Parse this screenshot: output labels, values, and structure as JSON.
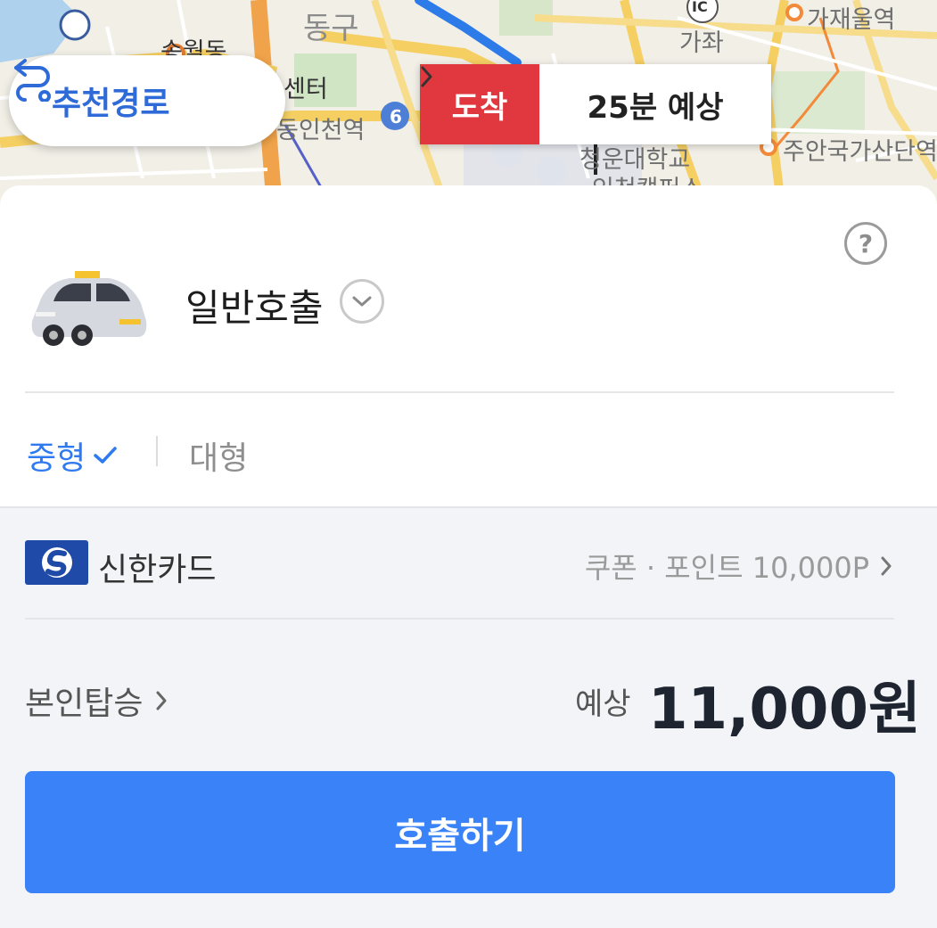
{
  "map": {
    "labels": {
      "donggu": "동구",
      "songwoldong": "송월동",
      "center_partial": "센터",
      "dongincheon_station": "동인천역",
      "gajae_station": "가재울역",
      "gaja": "가좌",
      "ic": "IC",
      "cheongun_univ": "청운대학교",
      "incheon_campus": "인천캠퍼스",
      "juan_industrial": "주안국가산단역",
      "route_number": "6"
    },
    "route_button": {
      "icon": "route-icon",
      "label": "추천경로"
    },
    "arrival": {
      "tag": "도착",
      "eta": "25분 예상",
      "colors": {
        "tag": "#e0383e"
      }
    }
  },
  "service": {
    "name": "일반호출",
    "help": "?",
    "icon": "taxi-icon",
    "sizes": [
      {
        "label": "중형",
        "selected": true
      },
      {
        "label": "대형",
        "selected": false
      }
    ]
  },
  "payment": {
    "card_name": "신한카드",
    "coupon_text": "쿠폰 · 포인트 10,000P"
  },
  "ride": {
    "rider_label": "본인탑승",
    "fare_label": "예상",
    "fare_value": "11,000원"
  },
  "actions": {
    "call_label": "호출하기"
  },
  "colors": {
    "accent": "#3a82f7",
    "selected_text": "#2f7af0"
  }
}
